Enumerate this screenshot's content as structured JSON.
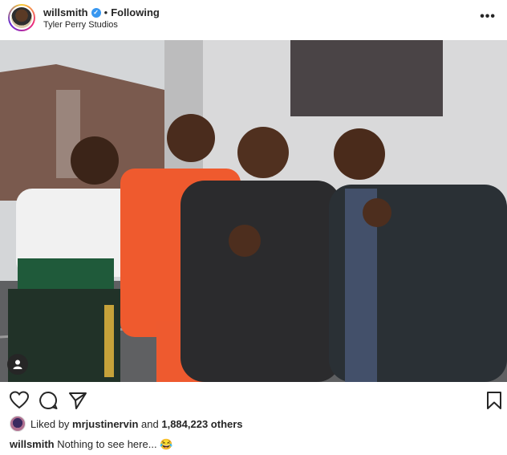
{
  "header": {
    "username": "willsmith",
    "separator": "•",
    "follow_status": "Following",
    "location": "Tyler Perry Studios",
    "verified_icon": "verified-badge-icon",
    "more_icon": "more-options-icon",
    "more_label": "•••"
  },
  "post": {
    "photo_icon": "photo",
    "user_tag_icon": "user-tag-icon"
  },
  "actions": {
    "like_icon": "heart-icon",
    "comment_icon": "comment-icon",
    "share_icon": "share-icon",
    "save_icon": "bookmark-icon"
  },
  "likes": {
    "prefix": "Liked by",
    "liker": "mrjustinervin",
    "connector": "and",
    "count": "1,884,223 others"
  },
  "caption": {
    "username": "willsmith",
    "text": "Nothing to see here... 😂"
  },
  "colors": {
    "accent": "#3897f0",
    "text": "#262626",
    "verified": "#3897f0"
  }
}
